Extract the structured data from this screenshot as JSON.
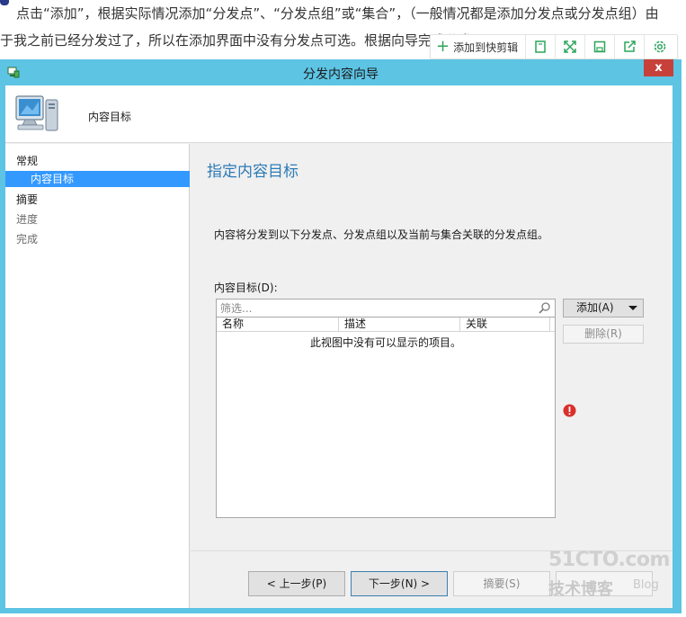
{
  "article": {
    "line1": "点击“添加”，根据实际情况添加“分发点”、“分发点组”或“集合”，（一般情况都是添加分发点或分发点组）由",
    "line2": "于我之前已经分发过了，所以在添加界面中没有分发点可选。根据向导完成分发"
  },
  "floating_toolbar": {
    "clip_label": "添加到快剪辑",
    "icons": [
      "bookmark-icon",
      "expand-icon",
      "save-icon",
      "share-icon",
      "settings-icon"
    ]
  },
  "dialog": {
    "title": "分发内容向导",
    "close_label": "x",
    "header_title": "内容目标",
    "nav": {
      "items": [
        {
          "label": "常规"
        },
        {
          "label": "内容目标"
        },
        {
          "label": "摘要"
        },
        {
          "label": "进度"
        },
        {
          "label": "完成"
        }
      ]
    },
    "content": {
      "title": "指定内容目标",
      "description": "内容将分发到以下分发点、分发点组以及当前与集合关联的分发点组。",
      "targets_label": "内容目标(D):",
      "filter_placeholder": "筛选...",
      "columns": [
        "名称",
        "描述",
        "关联"
      ],
      "empty_text": "此视图中没有可以显示的项目。",
      "add_label": "添加(A)",
      "remove_label": "删除(R)"
    },
    "footer": {
      "prev_label": "< 上一步(P)",
      "next_label": "下一步(N) >",
      "summary_label": "摘要(S)"
    }
  },
  "watermark": {
    "main": "51CTO.com",
    "sub": "技术博客",
    "blog": "Blog"
  },
  "colors": {
    "titlebar": "#5dc4e4",
    "close": "#c7413a",
    "nav_selected": "#3399ff",
    "content_title": "#2e7bb6",
    "error": "#d9302c"
  }
}
